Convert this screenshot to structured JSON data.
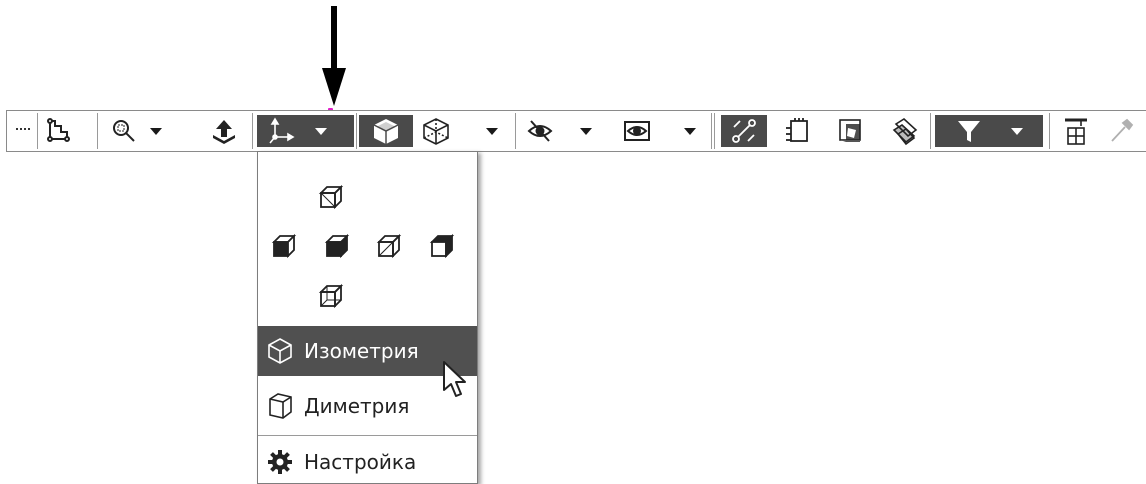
{
  "toolbar": {
    "icons": [
      "grip-icon",
      "sketch-frame-icon",
      "zoom-icon",
      "zoom-dropdown-icon",
      "normal-to-icon",
      "orientation-icon",
      "orientation-dropdown-icon",
      "shaded-cube-icon",
      "wireframe-cube-icon",
      "display-style-dropdown-icon",
      "hide-icon",
      "hide-dropdown-icon",
      "show-icon",
      "show-dropdown-icon",
      "constraints-icon",
      "section-icon",
      "shadow-cube-icon",
      "perspective-icon",
      "filter-icon",
      "filter-dropdown-icon",
      "spec-tree-icon",
      "pipette-icon"
    ]
  },
  "menu": {
    "view_cubes": [
      "top-view-icon",
      "left-view-icon",
      "front-view-icon",
      "right-view-icon",
      "back-view-icon",
      "bottom-view-icon"
    ],
    "items": [
      {
        "label": "Изометрия",
        "icon": "isometric-cube-icon",
        "highlighted": true
      },
      {
        "label": "Диметрия",
        "icon": "dimetric-cube-icon",
        "highlighted": false
      },
      {
        "label": "Настройка",
        "icon": "gear-icon",
        "highlighted": false
      }
    ]
  },
  "colors": {
    "highlight": "#505050",
    "toolbar_dark": "#4a4a4a",
    "indicator": "#e020c8"
  }
}
